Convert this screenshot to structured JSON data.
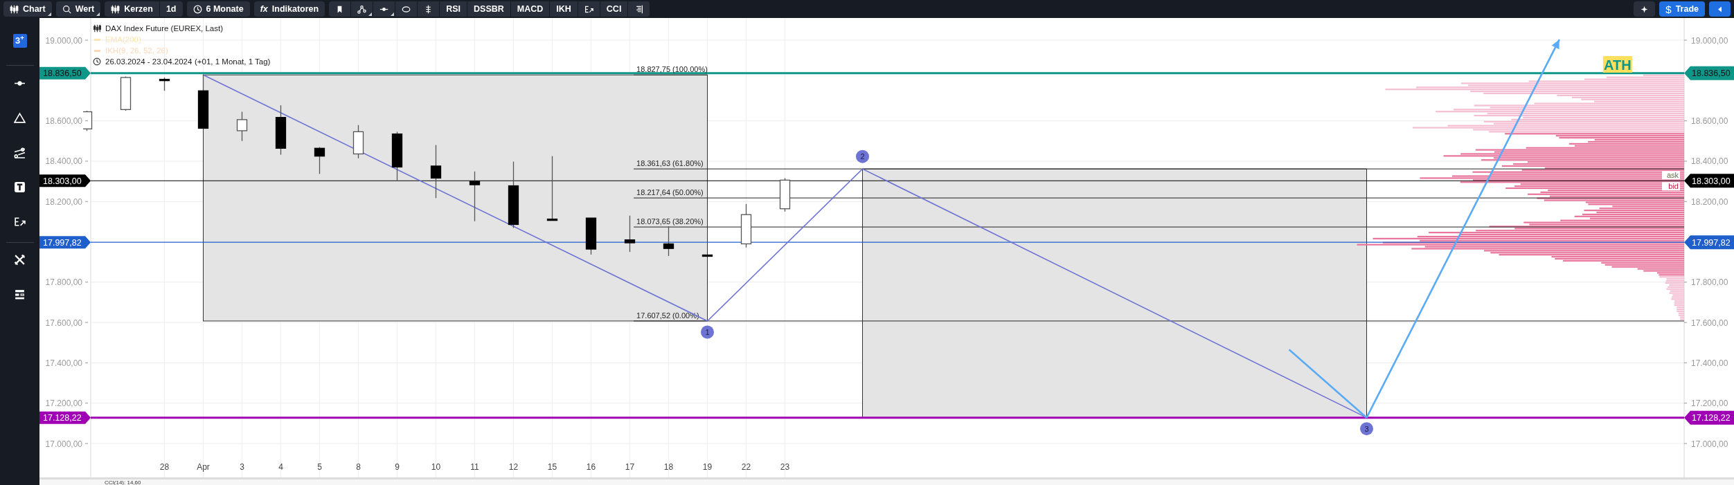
{
  "toolbar": {
    "chart_menu": "Chart",
    "search": "Wert",
    "chart_type": "Kerzen",
    "interval": "1d",
    "range": "6 Monate",
    "indicators": {
      "symbol": "fx",
      "label": "Indikatoren"
    },
    "quick_indicators": [
      "RSI",
      "DSSBR",
      "MACD",
      "IKH",
      "CCI"
    ],
    "trade": {
      "symbol": "$",
      "label": "Trade"
    }
  },
  "sidebar": {
    "logo": "3$^{+}$"
  },
  "chart": {
    "legend": {
      "instrument": "DAX Index Future (EUREX, Last)",
      "indicators": [
        {
          "label": "EMA(200)",
          "color": "#fde4b4"
        },
        {
          "label": "IKH(9, 26, 52, 26)",
          "color": "#fcd7b8"
        }
      ],
      "date_range": "26.03.2024 - 23.04.2024",
      "period_note": "(+01, 1 Monat, 1 Tag)"
    },
    "left_axis": {
      "labels": [
        "19.000,00",
        "18.600,00",
        "18.400,00",
        "18.200,00",
        "17.800,00",
        "17.600,00",
        "17.400,00",
        "17.200,00",
        "17.000,00"
      ],
      "price_tags": [
        "18.836,50",
        "18.303,00",
        "17.997,82",
        "17.128,22"
      ]
    },
    "chart_data": {
      "type": "candlestick",
      "ylim": [
        16832,
        19110
      ],
      "categories": [
        null,
        null,
        "28",
        "Apr",
        "3",
        "4",
        "5",
        "8",
        "9",
        "10",
        "11",
        "12",
        "15",
        "16",
        "17",
        "18",
        "19",
        "22",
        "23"
      ],
      "ohlc": [
        [
          18560,
          18650,
          18550,
          18645
        ],
        [
          18656,
          18820,
          18650,
          18815
        ],
        [
          18806,
          18815,
          18749,
          18800
        ],
        [
          18749,
          18830,
          18560,
          18563
        ],
        [
          18551,
          18645,
          18500,
          18606
        ],
        [
          18617,
          18677,
          18432,
          18464
        ],
        [
          18464,
          18470,
          18337,
          18425
        ],
        [
          18436,
          18579,
          18414,
          18546
        ],
        [
          18535,
          18546,
          18305,
          18371
        ],
        [
          18376,
          18480,
          18217,
          18316
        ],
        [
          18300,
          18349,
          18102,
          18283
        ],
        [
          18278,
          18398,
          18069,
          18086
        ],
        [
          18113,
          18425,
          18107,
          18110
        ],
        [
          18118,
          18118,
          17937,
          17964
        ],
        [
          18010,
          18130,
          17950,
          17995
        ],
        [
          17990,
          18077,
          17930,
          17967
        ],
        [
          17935,
          17937,
          17928,
          17930
        ],
        [
          17990,
          18188,
          17972,
          18135
        ],
        [
          18164,
          18316,
          18150,
          18306
        ]
      ],
      "yticks": [
        {
          "value": 19000,
          "label": "19.000,00"
        },
        {
          "value": 18600,
          "label": "18.600,00"
        },
        {
          "value": 18400,
          "label": "18.400,00"
        },
        {
          "value": 18200,
          "label": "18.200,00"
        },
        {
          "value": 17800,
          "label": "17.800,00"
        },
        {
          "value": 17600,
          "label": "17.600,00"
        },
        {
          "value": 17400,
          "label": "17.400,00"
        },
        {
          "value": 17200,
          "label": "17.200,00"
        },
        {
          "value": 17000,
          "label": "17.000,00"
        }
      ],
      "grid": true,
      "ref_lines": [
        {
          "axis": "y",
          "value": 18836.5,
          "label": "18.836,50",
          "color": "#0e9688"
        },
        {
          "axis": "y",
          "value": 18303,
          "label": "18.303,00",
          "color": "#000000"
        },
        {
          "axis": "y",
          "value": 17997.82,
          "label": "17.997,82",
          "color": "#1f5fcc"
        },
        {
          "axis": "y",
          "value": 17128.22,
          "label": "17.128,22",
          "color": "#a000b4"
        }
      ]
    },
    "drawings": {
      "fib_levels": [
        "18.827,75 (100.00%)",
        "18.361,63 (61.80%)",
        "18.217,64 (50.00%)",
        "18.073,65 (38.20%)",
        "17.607,52 (0.00%)"
      ],
      "point_labels": [
        "1",
        "2",
        "3"
      ],
      "ath": "ATH",
      "ask": "ask",
      "bid": "bid"
    },
    "bottom_panel": {
      "indicator": "CCI(14): 14,60"
    }
  }
}
